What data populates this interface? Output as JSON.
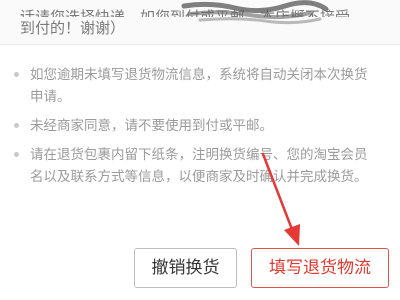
{
  "top_card": {
    "partial_text": "到付的！谢谢）",
    "hidden_text_top": "话请您选择快递，如您到付或平邮，本店概不接受"
  },
  "notices": [
    {
      "text": "如您逾期未填写退货物流信息，系统将自动关闭本次换货申请。"
    },
    {
      "text": "未经商家同意，请不要使用到付或平邮。"
    },
    {
      "text": "请在退货包裹内留下纸条，注明换货编号、您的淘宝会员名以及联系方式等信息，以便商家及时确认并完成换货。"
    }
  ],
  "actions": {
    "cancel_label": "撤销换货",
    "fill_label": "填写退货物流"
  },
  "colors": {
    "accent": "#e2382f",
    "arrow": "#e53935",
    "muted_text": "#9b9b9b"
  },
  "icons": {
    "annotation": "arrow-pointer-icon"
  }
}
